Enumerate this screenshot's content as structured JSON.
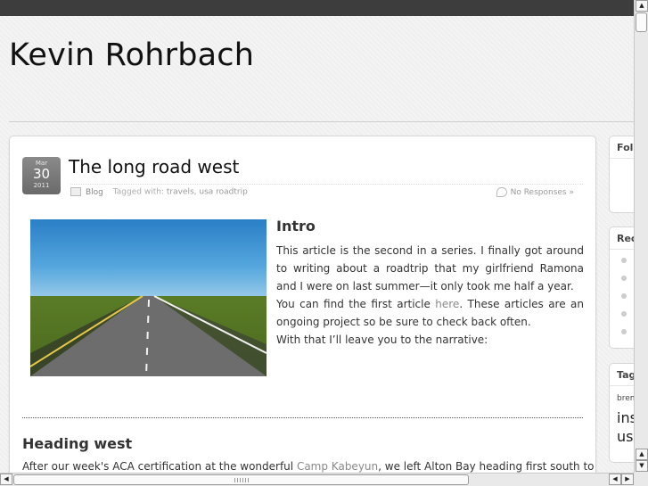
{
  "site": {
    "title": "Kevin Rohrbach"
  },
  "post": {
    "date": {
      "month": "Mar",
      "day": "30",
      "year": "2011"
    },
    "title": "The long road west",
    "meta": {
      "category": "Blog",
      "tags_label": "Tagged with:",
      "tags": "travels, usa roadtrip",
      "responses": "No Responses »"
    },
    "intro": {
      "heading": "Intro",
      "p1": "This article is the second in a series. I finally got around to writing about a roadtrip that my girlfriend Ramona and I were on last summer—it only took me half a year.",
      "p2_before": "You can find the first article ",
      "p2_link": "here",
      "p2_after": ". These articles are an ongoing project so be sure to check back often.",
      "p3": "With that I’ll leave you to the narrative:"
    },
    "section": {
      "heading": "Heading west",
      "p_before": "After our week's ACA certification at the wonderful ",
      "p_link": "Camp Kabeyun",
      "p_after": ", we left Alton Bay heading first south to"
    }
  },
  "sidebar": {
    "widgets": [
      {
        "title": "Follow"
      },
      {
        "title": "Recent"
      },
      {
        "title": "Tags",
        "items": [
          "bremen",
          "ins",
          "us"
        ]
      }
    ]
  },
  "icons": {
    "category": "folder-icon",
    "responses": "comment-icon"
  },
  "colors": {
    "link": "#8a8a8a",
    "badge": "#7a7a7a"
  }
}
